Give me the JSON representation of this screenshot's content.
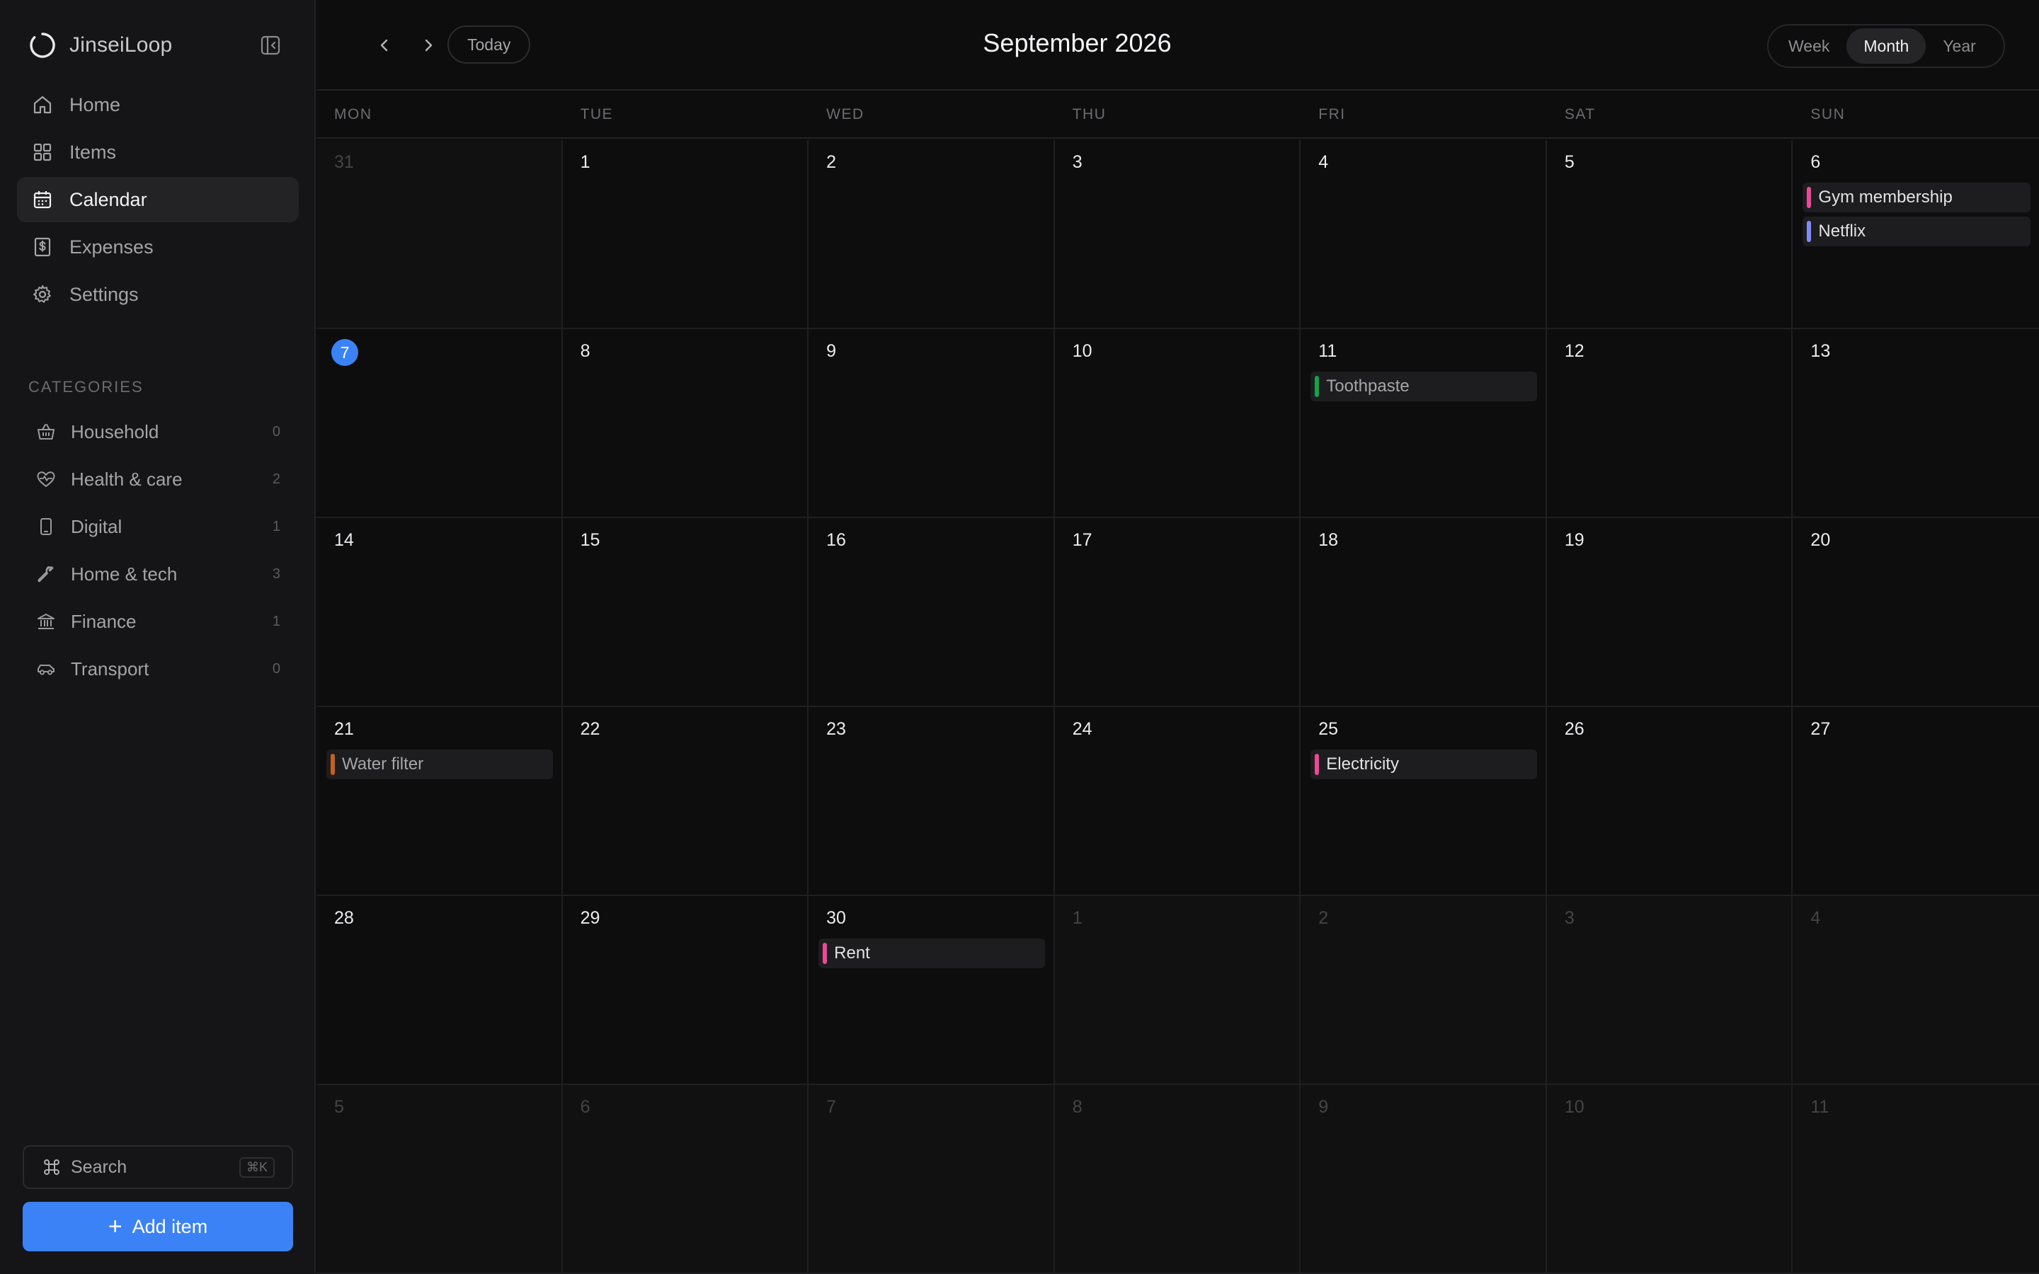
{
  "app": {
    "name": "JinseiLoop"
  },
  "sidebar": {
    "nav": [
      {
        "label": "Home",
        "icon": "home-icon"
      },
      {
        "label": "Items",
        "icon": "grid-icon"
      },
      {
        "label": "Calendar",
        "icon": "calendar-icon",
        "active": true
      },
      {
        "label": "Expenses",
        "icon": "dollar-icon"
      },
      {
        "label": "Settings",
        "icon": "gear-icon"
      }
    ],
    "categories_heading": "CATEGORIES",
    "categories": [
      {
        "label": "Household",
        "count": "0",
        "icon": "basket-icon"
      },
      {
        "label": "Health & care",
        "count": "2",
        "icon": "heart-pulse-icon"
      },
      {
        "label": "Digital",
        "count": "1",
        "icon": "phone-icon"
      },
      {
        "label": "Home & tech",
        "count": "3",
        "icon": "wrench-icon"
      },
      {
        "label": "Finance",
        "count": "1",
        "icon": "bank-icon"
      },
      {
        "label": "Transport",
        "count": "0",
        "icon": "car-icon"
      }
    ],
    "search": {
      "label": "Search",
      "shortcut": "⌘K"
    },
    "add_button": {
      "label": "Add item"
    }
  },
  "toolbar": {
    "today_label": "Today",
    "title": "September 2026",
    "views": [
      {
        "label": "Week"
      },
      {
        "label": "Month",
        "active": true
      },
      {
        "label": "Year"
      }
    ]
  },
  "calendar": {
    "weekdays": [
      "MON",
      "TUE",
      "WED",
      "THU",
      "FRI",
      "SAT",
      "SUN"
    ],
    "today_day": "7",
    "colors": {
      "pink": "#ec4899",
      "indigo": "#818cf8",
      "green": "#16a34a",
      "orange": "#c2621c",
      "accent": "#3b82f6"
    },
    "cells": [
      {
        "day": "31",
        "out": true,
        "events": []
      },
      {
        "day": "1",
        "events": []
      },
      {
        "day": "2",
        "events": []
      },
      {
        "day": "3",
        "events": []
      },
      {
        "day": "4",
        "events": []
      },
      {
        "day": "5",
        "events": []
      },
      {
        "day": "6",
        "events": [
          {
            "title": "Gym membership",
            "color": "#ec4899"
          },
          {
            "title": "Netflix",
            "color": "#818cf8"
          }
        ]
      },
      {
        "day": "7",
        "today": true,
        "events": []
      },
      {
        "day": "8",
        "events": []
      },
      {
        "day": "9",
        "events": []
      },
      {
        "day": "10",
        "events": []
      },
      {
        "day": "11",
        "events": [
          {
            "title": "Toothpaste",
            "color": "#16a34a",
            "muted": true
          }
        ]
      },
      {
        "day": "12",
        "events": []
      },
      {
        "day": "13",
        "events": []
      },
      {
        "day": "14",
        "events": []
      },
      {
        "day": "15",
        "events": []
      },
      {
        "day": "16",
        "events": []
      },
      {
        "day": "17",
        "events": []
      },
      {
        "day": "18",
        "events": []
      },
      {
        "day": "19",
        "events": []
      },
      {
        "day": "20",
        "events": []
      },
      {
        "day": "21",
        "events": [
          {
            "title": "Water filter",
            "color": "#c2621c",
            "muted": true
          }
        ]
      },
      {
        "day": "22",
        "events": []
      },
      {
        "day": "23",
        "events": []
      },
      {
        "day": "24",
        "events": []
      },
      {
        "day": "25",
        "events": [
          {
            "title": "Electricity",
            "color": "#ec4899"
          }
        ]
      },
      {
        "day": "26",
        "events": []
      },
      {
        "day": "27",
        "events": []
      },
      {
        "day": "28",
        "events": []
      },
      {
        "day": "29",
        "events": []
      },
      {
        "day": "30",
        "events": [
          {
            "title": "Rent",
            "color": "#ec4899"
          }
        ]
      },
      {
        "day": "1",
        "out": true,
        "events": []
      },
      {
        "day": "2",
        "out": true,
        "events": []
      },
      {
        "day": "3",
        "out": true,
        "events": []
      },
      {
        "day": "4",
        "out": true,
        "events": []
      },
      {
        "day": "5",
        "out": true,
        "events": []
      },
      {
        "day": "6",
        "out": true,
        "events": []
      },
      {
        "day": "7",
        "out": true,
        "events": []
      },
      {
        "day": "8",
        "out": true,
        "events": []
      },
      {
        "day": "9",
        "out": true,
        "events": []
      },
      {
        "day": "10",
        "out": true,
        "events": []
      },
      {
        "day": "11",
        "out": true,
        "events": []
      }
    ]
  }
}
